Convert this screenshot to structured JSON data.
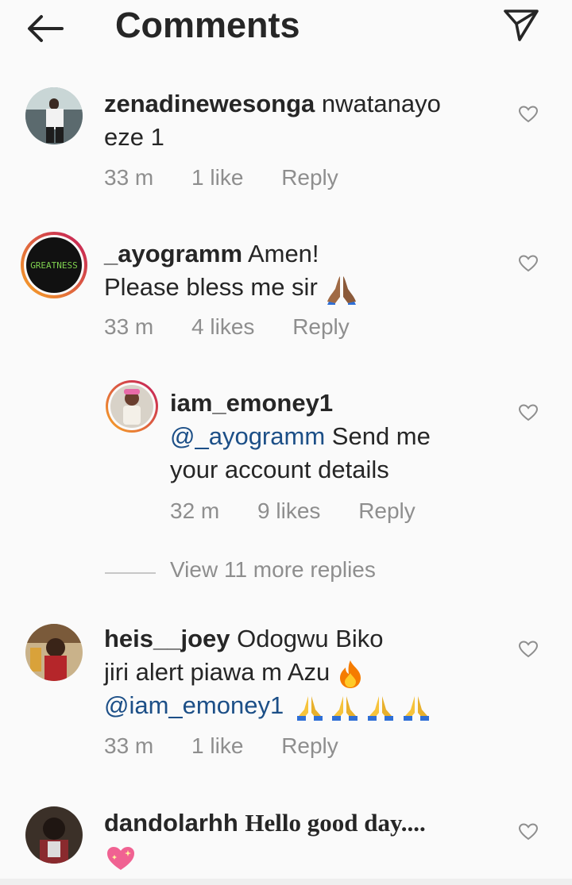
{
  "header": {
    "title": "Comments",
    "back_icon": "back-arrow-icon",
    "send_icon": "send-paper-plane-icon"
  },
  "comments": [
    {
      "username": "zenadinewesonga",
      "text_line1": "nwatanayo",
      "text_line2": "eze 1",
      "time": "33 m",
      "likes": "1 like",
      "reply": "Reply"
    },
    {
      "username": "_ayogramm",
      "text_line1": "Amen!",
      "text_line2": "Please bless me sir",
      "avatar_text": "GREATNESS",
      "time": "33 m",
      "likes": "4 likes",
      "reply": "Reply"
    },
    {
      "username": "iam_emoney1",
      "mention": "@_ayogramm",
      "text_line1": "Send me",
      "text_line2": "your account details",
      "time": "32 m",
      "likes": "9 likes",
      "reply": "Reply"
    },
    {
      "username": "heis__joey",
      "text_line1": "Odogwu Biko",
      "text_line2": "jiri alert piawa m Azu",
      "mention": "@iam_emoney1",
      "time": "33 m",
      "likes": "1 like",
      "reply": "Reply"
    },
    {
      "username": "dandolarhh",
      "text_line1": "Hello good day....",
      "time": "",
      "likes": "",
      "reply": ""
    }
  ],
  "view_more": "View 11 more replies",
  "colors": {
    "background": "#fafafa",
    "text": "#262626",
    "secondary": "#8e8e8e",
    "mention": "#1c4f87",
    "story_ring_start": "#f9a825",
    "story_ring_end": "#c2185b"
  }
}
